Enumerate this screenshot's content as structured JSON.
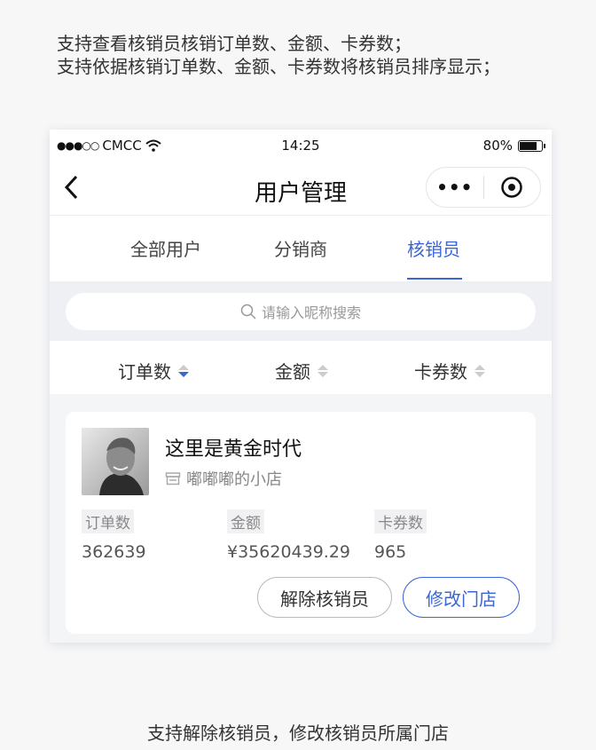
{
  "description": {
    "line1": "支持查看核销员核销订单数、金额、卡券数；",
    "line2": "支持依据核销订单数、金额、卡券数将核销员排序显示；",
    "bottom": "支持解除核销员，修改核销员所属门店"
  },
  "statusbar": {
    "dots": "●●●○○",
    "carrier": "CMCC",
    "time": "14:25",
    "battery": "80%",
    "battery_level": 0.8
  },
  "navbar": {
    "back_icon": "chevron-left-icon",
    "title": "用户管理",
    "more": "•••"
  },
  "tabs": [
    {
      "label": "全部用户",
      "active": false
    },
    {
      "label": "分销商",
      "active": false
    },
    {
      "label": "核销员",
      "active": true
    }
  ],
  "search": {
    "placeholder": "请输入昵称搜索"
  },
  "sort": [
    {
      "label": "订单数",
      "active": true
    },
    {
      "label": "金额",
      "active": false
    },
    {
      "label": "卡券数",
      "active": false
    }
  ],
  "card": {
    "name": "这里是黄金时代",
    "shop": "嘟嘟嘟的小店",
    "stats": [
      {
        "label": "订单数",
        "value": "362639"
      },
      {
        "label": "金额",
        "value": "¥35620439.29"
      },
      {
        "label": "卡券数",
        "value": "965"
      }
    ],
    "remove_label": "解除核销员",
    "modify_label": "修改门店"
  },
  "colors": {
    "accent": "#3b66d6",
    "page_bg": "#f7f7f7"
  }
}
